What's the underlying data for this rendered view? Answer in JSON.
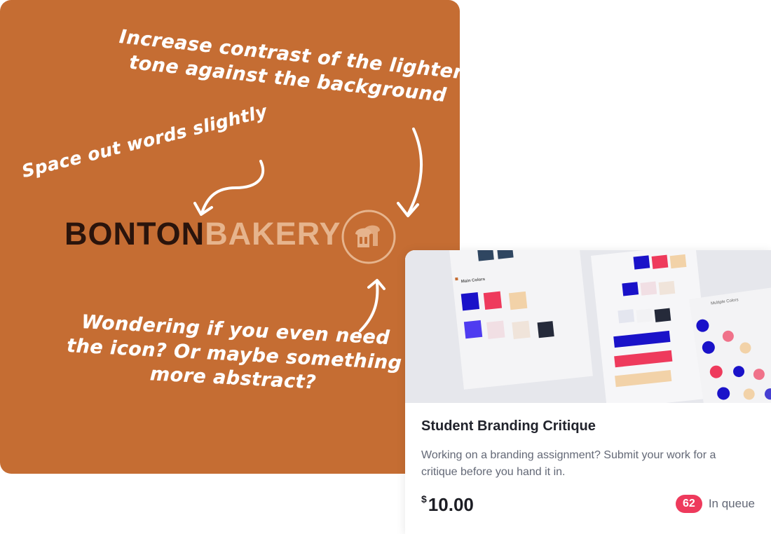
{
  "critique": {
    "note_top": [
      "Increase contrast of the lighter",
      "tone against the background"
    ],
    "note_left": [
      "Space out words slightly"
    ],
    "note_bottom": [
      "Wondering if you even need",
      "the icon? Or maybe something",
      "more abstract?"
    ],
    "wordmark": {
      "dark": "BONTON",
      "light": "BAKERY"
    },
    "colors": {
      "panel": "#c56d33",
      "wordmark_dark": "#2a140c",
      "wordmark_light": "#e6b48d"
    }
  },
  "card": {
    "image_label": "Main Colors",
    "image_alt_label": "Multiple Colors",
    "title": "Student Branding Critique",
    "description": "Working on a branding assignment? Submit your work for a critique before you hand it in.",
    "price": {
      "currency": "$",
      "amount": "10.00"
    },
    "queue": {
      "count": "62",
      "label": "In queue"
    },
    "colors": {
      "badge": "#ee3a5c"
    }
  }
}
